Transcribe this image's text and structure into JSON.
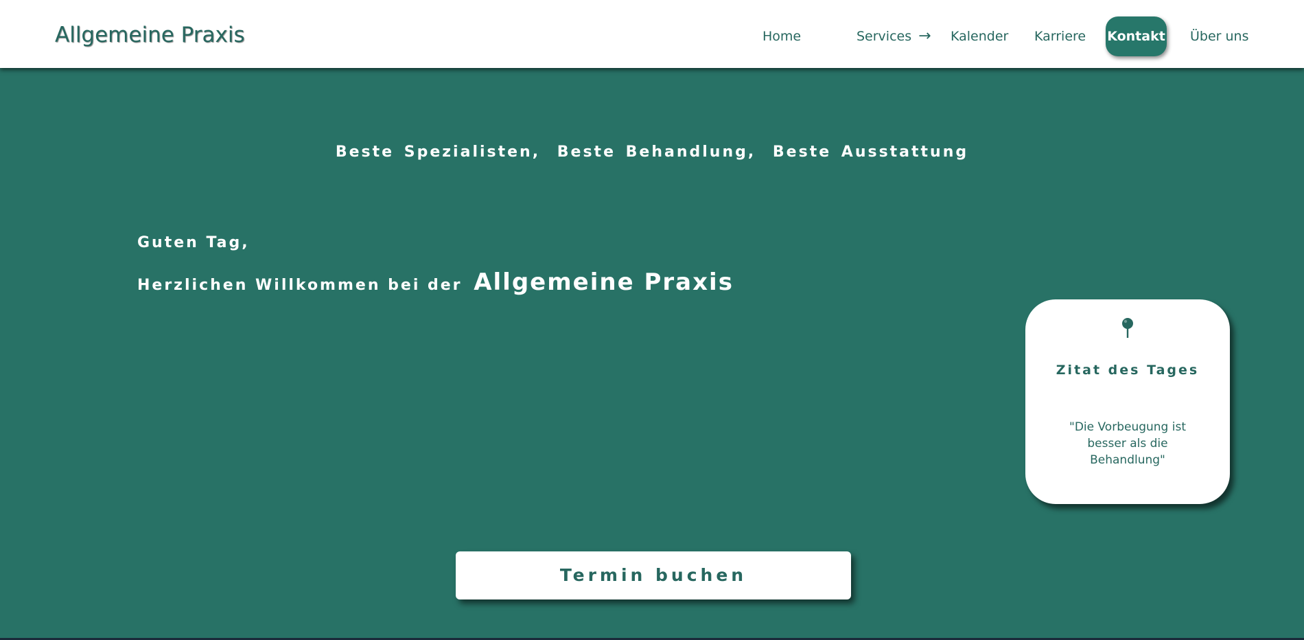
{
  "header": {
    "brand": "Allgemeine Praxis",
    "nav": [
      {
        "label": "Home"
      },
      {
        "label": "Services",
        "arrow": "→"
      },
      {
        "label": "Kalender"
      },
      {
        "label": "Karriere"
      },
      {
        "label": "Kontakt",
        "active": true
      },
      {
        "label": "Über uns"
      }
    ]
  },
  "hero": {
    "tagline": [
      "Beste Spezialisten,",
      "Beste Behandlung,",
      "Beste Ausstattung"
    ],
    "greeting": "Guten Tag,",
    "welcome_prefix": "Herzlichen Willkommen bei der",
    "welcome_practice": "Allgemeine Praxis",
    "cta_label": "Termin buchen"
  },
  "quote_card": {
    "icon": "pin-icon",
    "title": "Zitat des Tages",
    "text": "\"Die Vorbeugung ist besser als die Behandlung\""
  },
  "colors": {
    "primary": "#287266",
    "primary_text": "#27675f",
    "white": "#ffffff"
  }
}
